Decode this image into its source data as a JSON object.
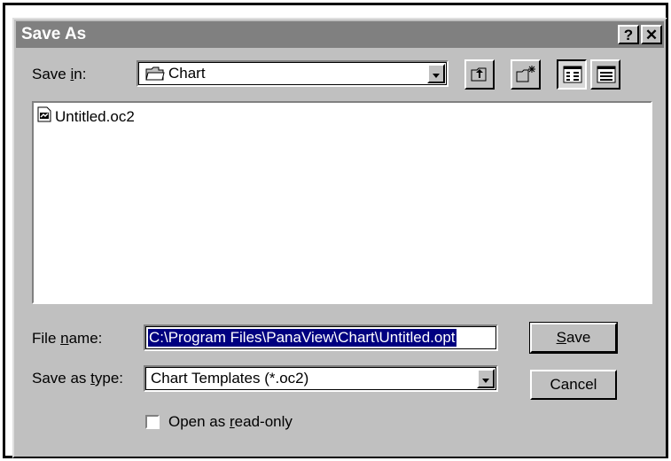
{
  "dialog": {
    "title": "Save As",
    "help_label": "?",
    "close_label": "✕"
  },
  "save_in": {
    "label_pre": "Save ",
    "label_key": "i",
    "label_post": "n:",
    "value": "Chart",
    "icon": "folder-icon"
  },
  "toolbar": {
    "up_icon": "up-one-level-icon",
    "new_folder_icon": "new-folder-icon",
    "list_icon": "list-view-icon",
    "details_icon": "details-view-icon"
  },
  "files": [
    {
      "name": "Untitled.oc2",
      "icon": "chart-file-icon"
    }
  ],
  "file_name": {
    "label_pre": "File ",
    "label_key": "n",
    "label_post": "ame:",
    "value": "C:\\Program Files\\PanaView\\Chart\\Untitled.opt"
  },
  "save_as_type": {
    "label_pre": "Save as ",
    "label_key": "t",
    "label_post": "ype:",
    "value": "Chart Templates (*.oc2)"
  },
  "buttons": {
    "save_key": "S",
    "save_rest": "ave",
    "cancel": "Cancel"
  },
  "read_only": {
    "label_pre": "Open as ",
    "label_key": "r",
    "label_post": "ead-only",
    "checked": false
  },
  "colors": {
    "dialog_face": "#c0c0c0",
    "titlebar": "#808080",
    "selection": "#000080"
  }
}
